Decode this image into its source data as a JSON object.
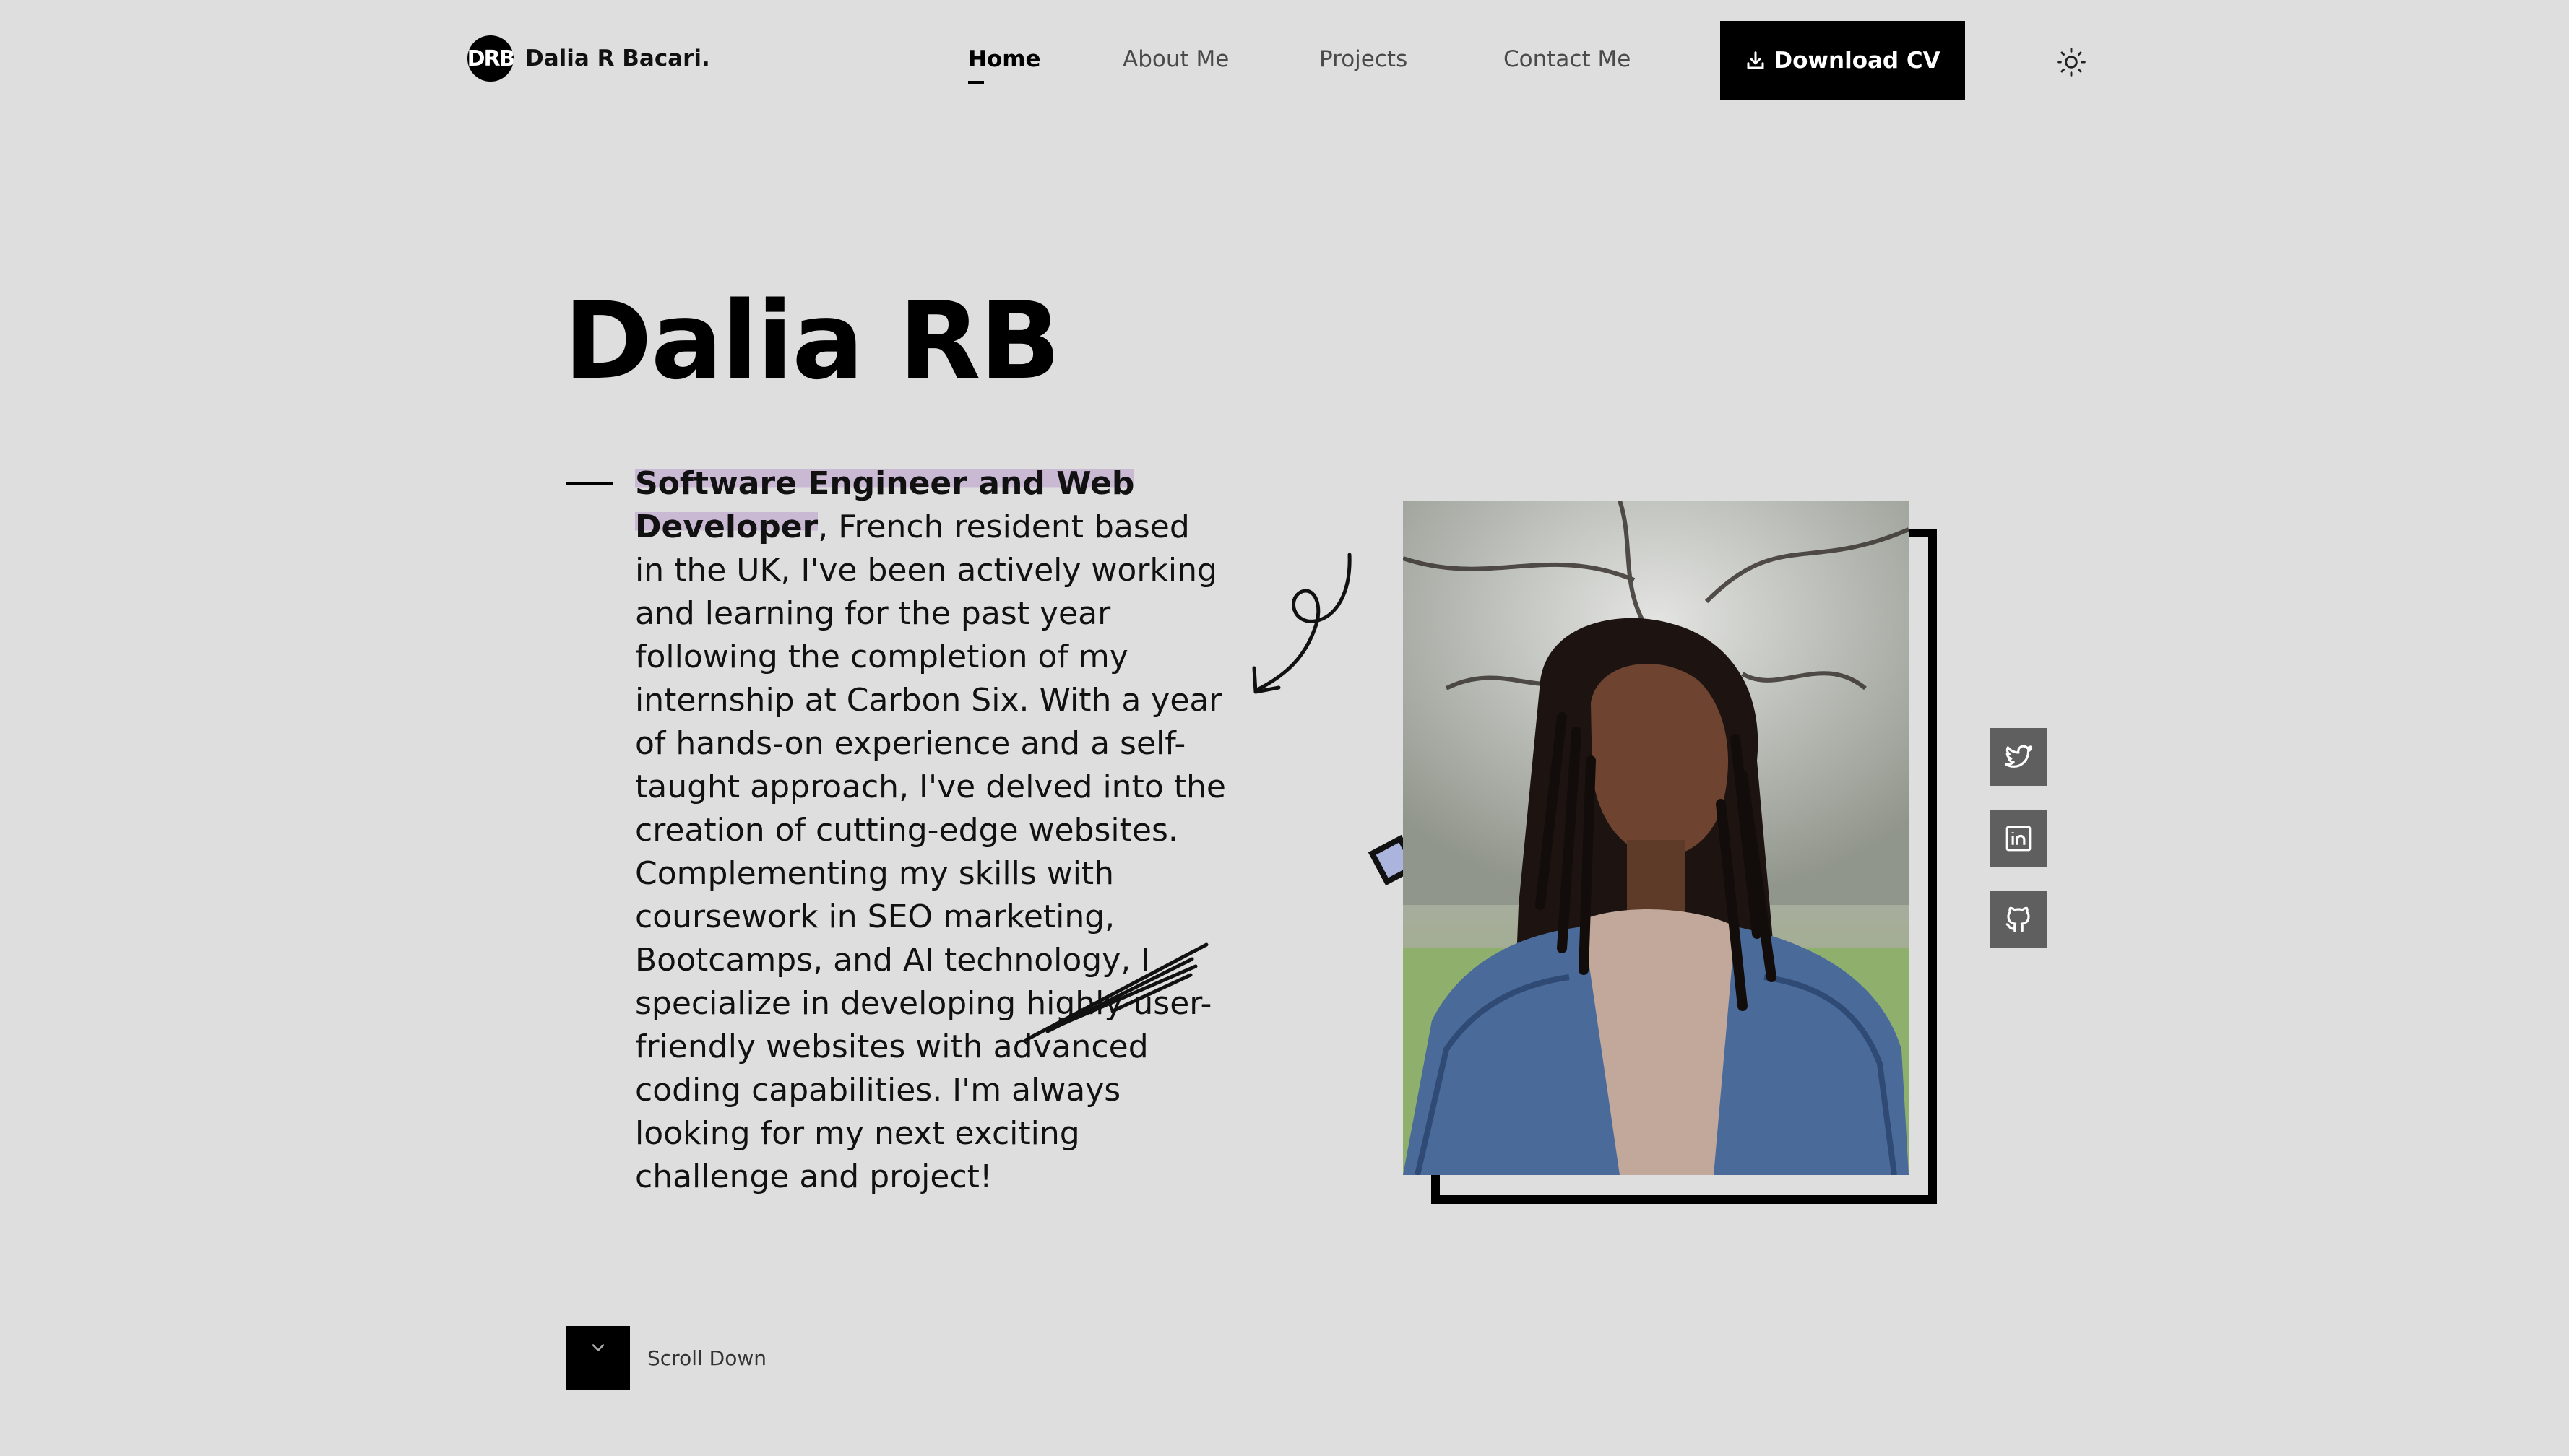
{
  "header": {
    "logo_text": "DRB",
    "brand_name": "Dalia R Bacari.",
    "nav": [
      {
        "label": "Home",
        "active": true
      },
      {
        "label": "About Me",
        "active": false
      },
      {
        "label": "Projects",
        "active": false
      },
      {
        "label": "Contact Me",
        "active": false
      }
    ],
    "download_label": "Download CV",
    "theme_icon": "sun-icon"
  },
  "hero": {
    "title": "Dalia RB",
    "role": "Software Engineer and Web Developer",
    "bio": ", French resident based in the UK, I've been actively working and learning for the past year following the completion of my internship at Carbon Six. With a year of hands-on experience and a self-taught approach, I've delved into the creation of cutting-edge websites. Complementing my skills with coursework in SEO marketing, Bootcamps, and AI technology, I specialize in developing highly user-friendly websites with advanced coding capabilities. I'm always looking for my next exciting challenge and project!"
  },
  "social": [
    {
      "icon": "twitter-icon"
    },
    {
      "icon": "linkedin-icon"
    },
    {
      "icon": "github-icon"
    }
  ],
  "scroll": {
    "label": "Scroll Down"
  },
  "colors": {
    "background": "#dedede",
    "accent": "#000000",
    "highlight": "#c9b9d3",
    "social_bg": "#5f5f5f"
  }
}
